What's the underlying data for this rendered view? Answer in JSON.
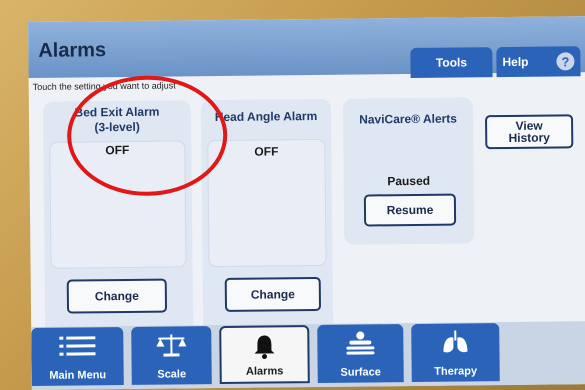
{
  "header": {
    "title": "Alarms"
  },
  "tabs": {
    "tools": "Tools",
    "help": "Help",
    "help_icon": "?"
  },
  "instruction": "Touch the setting you want to adjust",
  "bed_exit": {
    "title": "Bed Exit Alarm",
    "subtitle": "(3-level)",
    "value": "OFF",
    "button": "Change"
  },
  "head_angle": {
    "title": "Head Angle Alarm",
    "value": "OFF",
    "button": "Change"
  },
  "navicare": {
    "title": "NaviCare® Alerts",
    "status": "Paused",
    "button": "Resume"
  },
  "view_history": {
    "line1": "View",
    "line2": "History"
  },
  "nav": {
    "main_menu": "Main Menu",
    "scale": "Scale",
    "alarms": "Alarms",
    "surface": "Surface",
    "therapy": "Therapy"
  },
  "colors": {
    "accent": "#2b63b8",
    "highlight_oval": "#e01818"
  }
}
